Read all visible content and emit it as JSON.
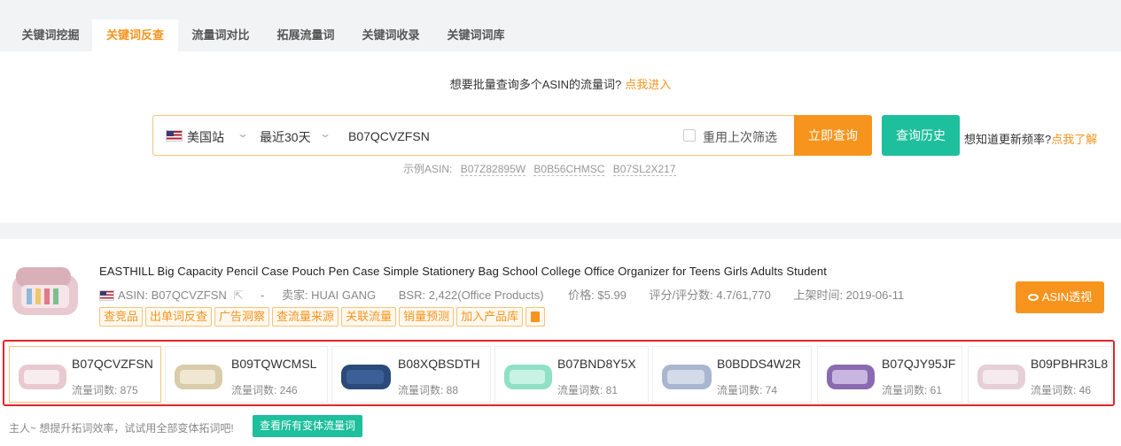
{
  "tabs": [
    {
      "label": "关键词挖掘",
      "active": false
    },
    {
      "label": "关键词反查",
      "active": true
    },
    {
      "label": "流量词对比",
      "active": false
    },
    {
      "label": "拓展流量词",
      "active": false
    },
    {
      "label": "关键词收录",
      "active": false
    },
    {
      "label": "关键词词库",
      "active": false
    }
  ],
  "batch": {
    "text": "想要批量查询多个ASIN的流量词?",
    "link": "点我进入"
  },
  "search": {
    "market": "美国站",
    "period": "最近30天",
    "asin_value": "B07QCVZFSN",
    "reuse_label": "重用上次筛选",
    "query_button": "立即查询",
    "history_button": "查询历史",
    "freq_text": "想知道更新频率?",
    "freq_link": "点我了解",
    "examples_label": "示例ASIN:",
    "examples": [
      "B07Z82895W",
      "B0B56CHMSC",
      "B07SL2X217"
    ]
  },
  "product": {
    "title": "EASTHILL Big Capacity Pencil Case Pouch Pen Case Simple Stationery Bag School College Office Organizer for Teens Girls Adults Student",
    "asin": "ASIN: B07QCVZFSN",
    "separator": "-",
    "seller": "卖家: HUAI GANG",
    "bsr": "BSR: 2,422(Office Products)",
    "price": "价格: $5.99",
    "rating": "评分/评分数: 4.7/61,770",
    "listed": "上架时间: 2019-06-11",
    "tags": [
      "查竞品",
      "出单词反查",
      "广告洞察",
      "查流量来源",
      "关联流量",
      "销量预测",
      "加入产品库"
    ],
    "asin_view_button": "ASIN透视"
  },
  "variants": [
    {
      "asin": "B07QCVZFSN",
      "count": "流量词数: 875",
      "color": "#e8c9cf",
      "selected": true
    },
    {
      "asin": "B09TQWCMSL",
      "count": "流量词数: 246",
      "color": "#d8ccaa",
      "selected": false
    },
    {
      "asin": "B08XQBSDTH",
      "count": "流量词数: 88",
      "color": "#2a4a7a",
      "selected": false
    },
    {
      "asin": "B07BND8Y5X",
      "count": "流量词数: 81",
      "color": "#8fe0c4",
      "selected": false
    },
    {
      "asin": "B0BDDS4W2R",
      "count": "流量词数: 74",
      "color": "#a9b6cf",
      "selected": false
    },
    {
      "asin": "B07QJY95JF",
      "count": "流量词数: 61",
      "color": "#8a6ab0",
      "selected": false
    },
    {
      "asin": "B09PBHR3L8",
      "count": "流量词数: 46",
      "color": "#e6cfd6",
      "selected": false
    }
  ],
  "hint": "主人~ 想提升拓词效率，试试用全部变体拓词吧!",
  "all_variants_button": "查看所有变体流量词"
}
